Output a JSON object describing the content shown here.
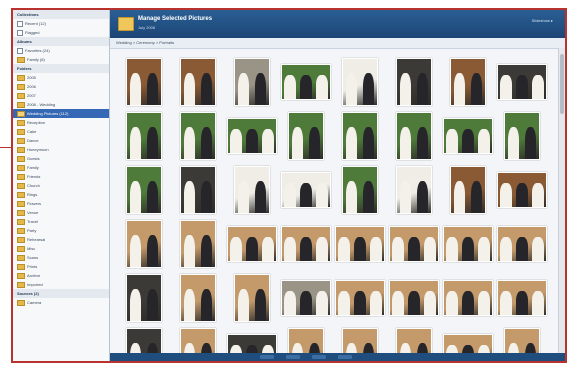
{
  "titlebar": {
    "title": "Manage Selected Pictures",
    "subtitle": "July 2008",
    "link": "Slideshow ▸"
  },
  "toolbar": {
    "breadcrumb": "Wedding > Ceremony > Portraits"
  },
  "sidebar": {
    "groups": [
      {
        "type": "head",
        "label": "Collections"
      },
      {
        "type": "check",
        "label": "Recent (12)"
      },
      {
        "type": "check",
        "label": "Flagged"
      },
      {
        "type": "head",
        "label": "Albums"
      },
      {
        "type": "check",
        "label": "Favorites (24)"
      },
      {
        "type": "folder",
        "label": "Family (8)"
      },
      {
        "type": "head",
        "label": "Folders"
      },
      {
        "type": "folder",
        "label": "2005"
      },
      {
        "type": "folder",
        "label": "2006"
      },
      {
        "type": "folder",
        "label": "2007"
      },
      {
        "type": "folder",
        "label": "2008 - Wedding"
      },
      {
        "type": "folder",
        "label": "Wedding Pictures (112)",
        "selected": true
      },
      {
        "type": "folder",
        "label": "Reception"
      },
      {
        "type": "folder",
        "label": "Cake"
      },
      {
        "type": "folder",
        "label": "Dance"
      },
      {
        "type": "folder",
        "label": "Honeymoon"
      },
      {
        "type": "folder",
        "label": "Guests"
      },
      {
        "type": "folder",
        "label": "Family"
      },
      {
        "type": "folder",
        "label": "Friends"
      },
      {
        "type": "folder",
        "label": "Church"
      },
      {
        "type": "folder",
        "label": "Rings"
      },
      {
        "type": "folder",
        "label": "Flowers"
      },
      {
        "type": "folder",
        "label": "Venue"
      },
      {
        "type": "folder",
        "label": "Travel"
      },
      {
        "type": "folder",
        "label": "Party"
      },
      {
        "type": "folder",
        "label": "Rehearsal"
      },
      {
        "type": "folder",
        "label": "Misc"
      },
      {
        "type": "folder",
        "label": "Scans"
      },
      {
        "type": "folder",
        "label": "Prints"
      },
      {
        "type": "folder",
        "label": "Archive"
      },
      {
        "type": "folder",
        "label": "Imported"
      },
      {
        "type": "head",
        "label": "Sources (2)"
      },
      {
        "type": "folder",
        "label": "Camera"
      }
    ]
  },
  "status": {
    "buttons": [
      "prev",
      "play",
      "next",
      "info"
    ]
  },
  "thumbnails": {
    "count": 54,
    "palette": {
      "green": "#4e7a3a",
      "brown": "#8a5a34",
      "tan": "#c49a6b",
      "dark": "#3b3a36",
      "grey": "#9a9486",
      "white": "#efede6"
    }
  }
}
